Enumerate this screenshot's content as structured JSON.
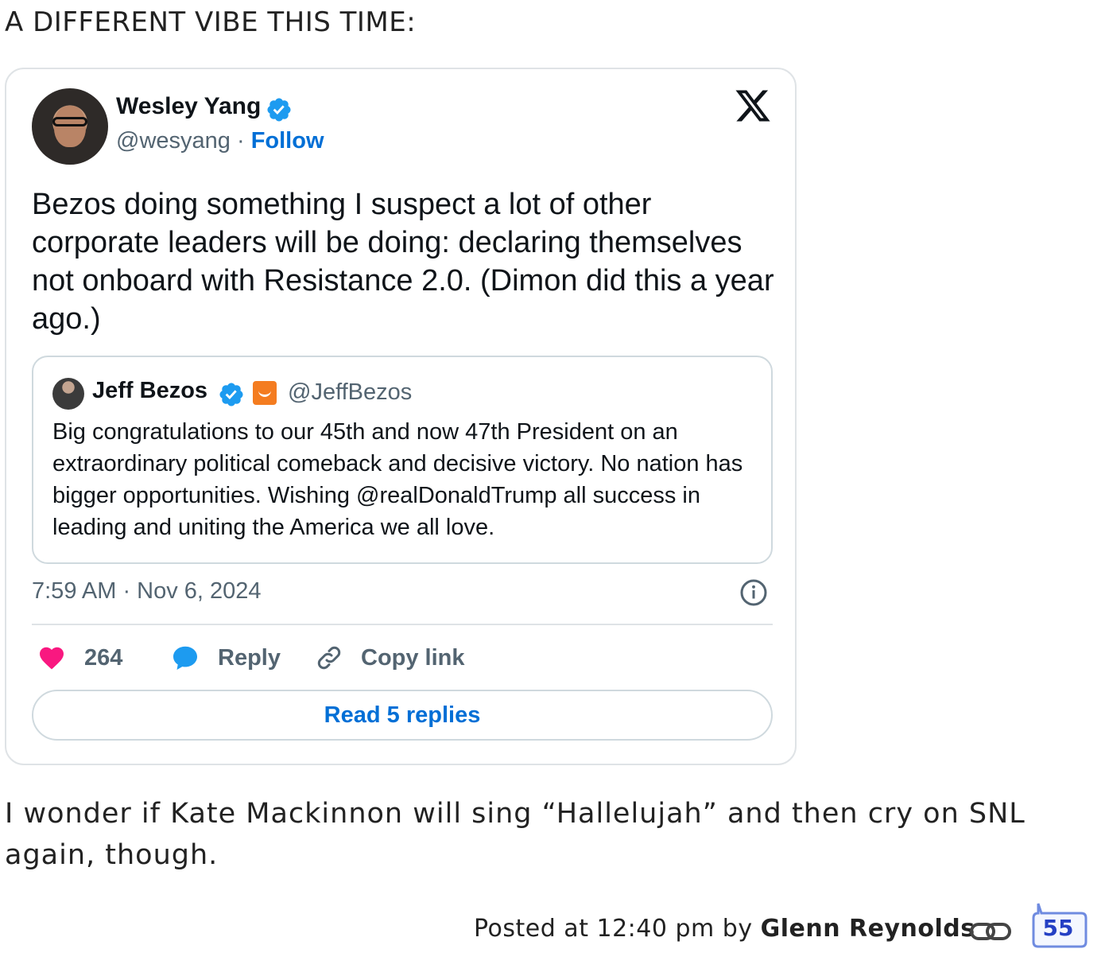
{
  "headline": "A DIFFERENT VIBE THIS TIME:",
  "tweet": {
    "author_name": "Wesley Yang",
    "handle": "@wesyang",
    "separator": " · ",
    "follow_label": "Follow",
    "text": "Bezos doing something I suspect a lot of other corporate leaders will be doing: declaring themselves not onboard with Resistance 2.0. (Dimon did this a year ago.)",
    "quote": {
      "author_name": "Jeff Bezos",
      "handle": "@JeffBezos",
      "text": "Big congratulations to our 45th and now 47th President on an extraordinary political comeback and decisive victory. No nation has bigger opportunities. Wishing @realDonaldTrump all success in leading and uniting the America we all love."
    },
    "timestamp": "7:59 AM · Nov 6, 2024",
    "likes": "264",
    "reply_label": "Reply",
    "copy_link_label": "Copy link",
    "read_replies_label": "Read 5 replies",
    "colors": {
      "like": "#f91880",
      "reply": "#1d9bf0",
      "link": "#006fd6",
      "verified": "#1d9bf0"
    },
    "icons": [
      "x-logo-icon",
      "verified-icon",
      "info-icon",
      "heart-icon",
      "reply-bubble-icon",
      "link-icon"
    ]
  },
  "body_text": "I wonder if Kate Mackinnon will sing “Hallelujah” and then cry on SNL again, though.",
  "footer": {
    "posted_prefix": "Posted at 12:40 pm by ",
    "author": "Glenn Reynolds",
    "comment_count": "55"
  }
}
